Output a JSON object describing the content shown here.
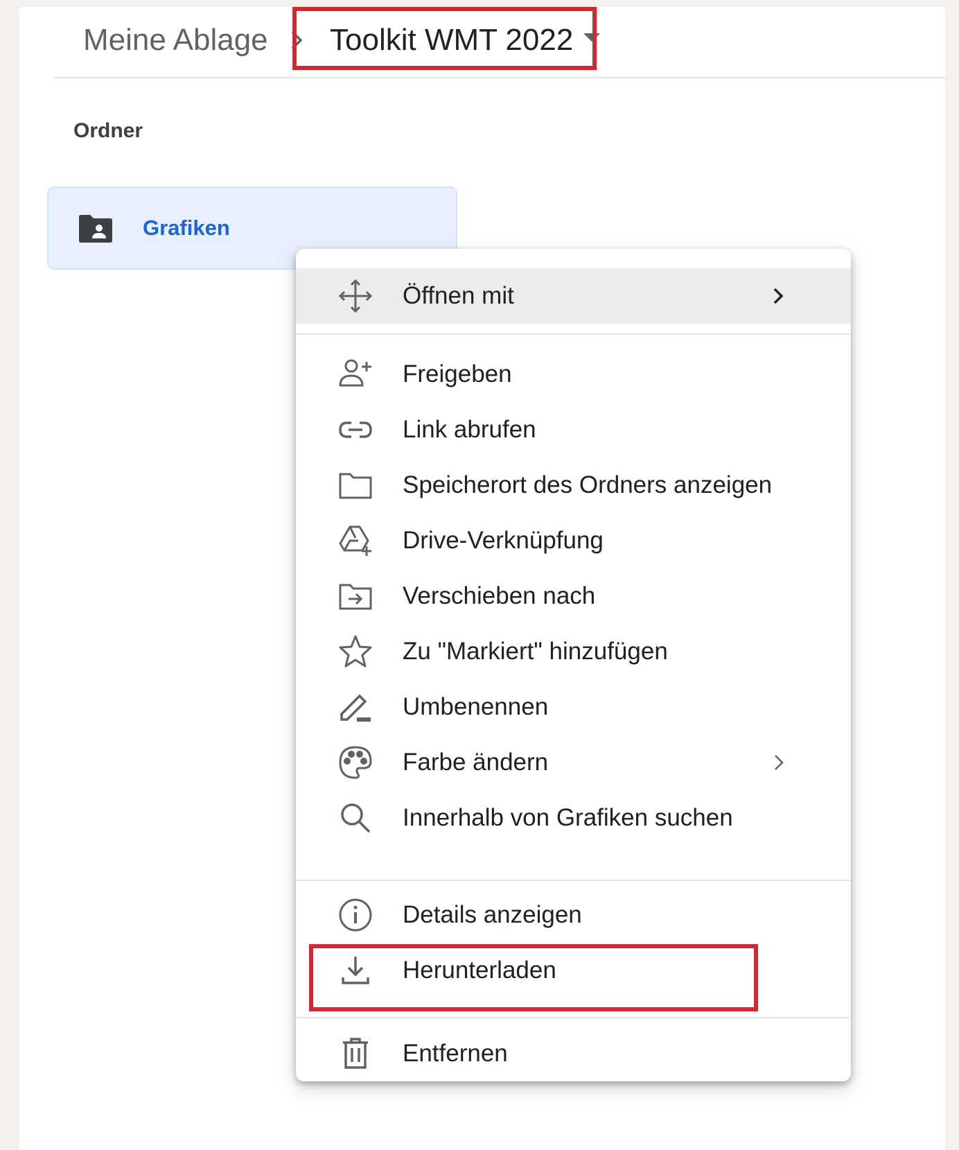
{
  "breadcrumb": {
    "root": "Meine Ablage",
    "current": "Toolkit WMT 2022"
  },
  "section": {
    "label": "Ordner"
  },
  "folder": {
    "name": "Grafiken",
    "icon": "shared-folder-icon"
  },
  "context_menu": {
    "open_with": {
      "label": "Öffnen mit",
      "icon": "move-arrows-icon"
    },
    "share": {
      "label": "Freigeben",
      "icon": "add-person-icon"
    },
    "get_link": {
      "label": "Link abrufen",
      "icon": "link-icon"
    },
    "show_location": {
      "label": "Speicherort des Ordners anzeigen",
      "icon": "folder-outline-icon"
    },
    "drive_shortcut": {
      "label": "Drive-Verknüpfung",
      "icon": "drive-shortcut-icon"
    },
    "move_to": {
      "label": "Verschieben nach",
      "icon": "folder-move-icon"
    },
    "add_starred": {
      "label": "Zu \"Markiert\" hinzufügen",
      "icon": "star-outline-icon"
    },
    "rename": {
      "label": "Umbenennen",
      "icon": "pencil-icon"
    },
    "change_color": {
      "label": "Farbe ändern",
      "icon": "palette-icon"
    },
    "search_within": {
      "label": "Innerhalb von Grafiken suchen",
      "icon": "search-icon"
    },
    "view_details": {
      "label": "Details anzeigen",
      "icon": "info-icon"
    },
    "download": {
      "label": "Herunterladen",
      "icon": "download-icon"
    },
    "remove": {
      "label": "Entfernen",
      "icon": "trash-icon"
    }
  },
  "colors": {
    "highlight": "#d12834",
    "folder_accent": "#1a66d6",
    "folder_bg": "#e8f0fe",
    "hover_bg": "#ececec",
    "icon": "#5f6368"
  }
}
